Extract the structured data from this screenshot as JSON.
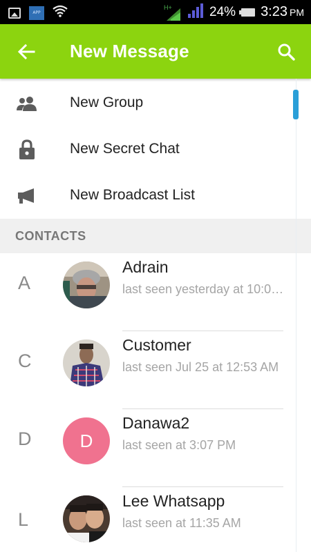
{
  "status_bar": {
    "app_icon_text": "APP",
    "network_label": "H+",
    "battery_percent": "24%",
    "time": "3:23",
    "ampm": "PM"
  },
  "app_bar": {
    "title": "New Message",
    "back_icon": "arrow-left-icon",
    "search_icon": "search-icon",
    "background_color": "#8cd40f"
  },
  "menu": {
    "items": [
      {
        "label": "New Group",
        "icon": "group-icon"
      },
      {
        "label": "New Secret Chat",
        "icon": "lock-icon"
      },
      {
        "label": "New Broadcast List",
        "icon": "megaphone-icon"
      }
    ]
  },
  "contacts": {
    "header": "CONTACTS",
    "list": [
      {
        "letter": "A",
        "name": "Adrain",
        "status": "last seen yesterday at 10:0…",
        "avatar": "photo"
      },
      {
        "letter": "C",
        "name": "Customer",
        "status": "last seen Jul 25 at 12:53 AM",
        "avatar": "photo"
      },
      {
        "letter": "D",
        "name": "Danawa2",
        "status": "last seen at 3:07 PM",
        "avatar": "initial",
        "initial": "D",
        "avatar_color": "#f0728f"
      },
      {
        "letter": "L",
        "name": "Lee Whatsapp",
        "status": "last seen at 11:35 AM",
        "avatar": "photo"
      }
    ]
  },
  "colors": {
    "accent": "#8cd40f",
    "scroll_thumb": "#2a9fd8"
  }
}
